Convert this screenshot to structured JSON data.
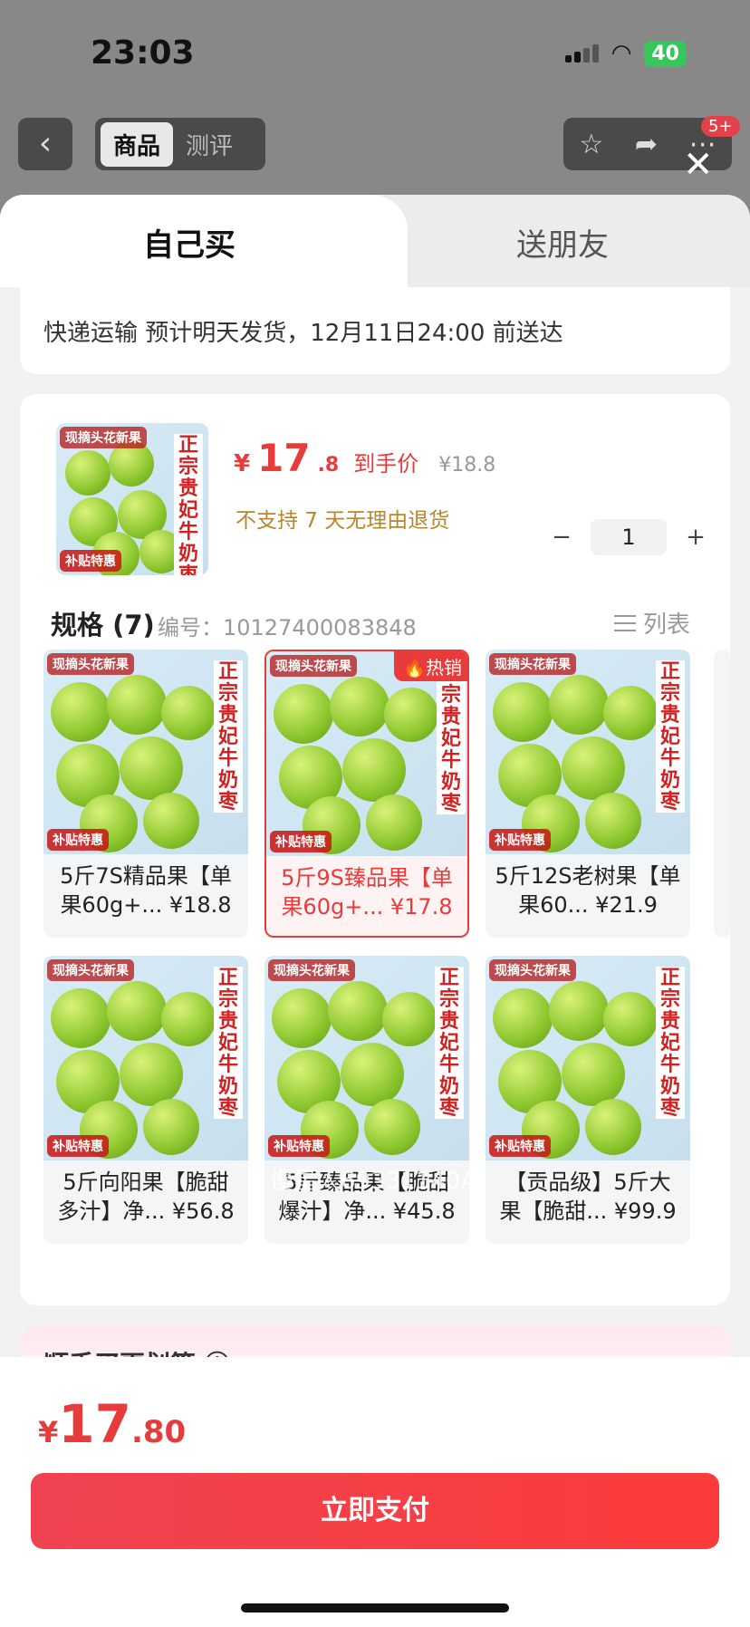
{
  "status_bar": {
    "time": "23:03",
    "battery": "40"
  },
  "nav": {
    "tab_product": "商品",
    "tab_review": "测评",
    "badge": "5+"
  },
  "sheet": {
    "tab_self": "自己买",
    "tab_gift": "送朋友",
    "delivery": "快递运输 预计明天发货，12月11日24:00 前送达"
  },
  "product": {
    "thumb_title": "正宗贵妃牛奶枣",
    "thumb_top": "现摘头花新果",
    "thumb_bottom": "补贴特惠",
    "price_yen": "¥",
    "price_int": "17",
    "price_dec": ".8",
    "price_label": "到手价",
    "orig_price": "¥18.8",
    "no_return": "不支持 7 天无理由退货",
    "qty": "1",
    "spec_head": "规格 (7)",
    "spec_code": "编号：10127400083848",
    "list_label": "列表",
    "hot_tag": "🔥热销",
    "watermark": "慢星人69331140A",
    "skus": [
      {
        "name": "5斤7S精品果【单果60g+... ¥18.8"
      },
      {
        "name": "5斤9S臻品果【单果60g+... ¥17.8"
      },
      {
        "name": "5斤12S老树果【单果60... ¥21.9"
      },
      {
        "name": "5斤向阳果【脆甜多汁】净... ¥56.8"
      },
      {
        "name": "5斤臻品果【脆甜爆汁】净... ¥45.8"
      },
      {
        "name": "【贡品级】5斤大果【脆甜... ¥99.9"
      }
    ]
  },
  "upsell": {
    "title": "顺手买更划算 ⓘ"
  },
  "footer": {
    "yen": "¥",
    "int": "17",
    "dec": ".80",
    "pay": "立即支付"
  }
}
